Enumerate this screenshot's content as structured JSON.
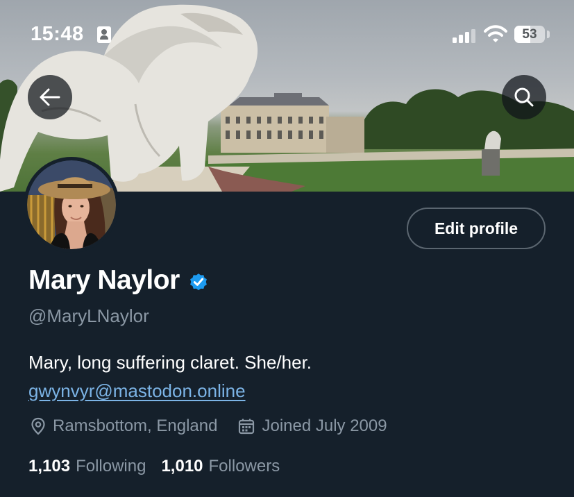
{
  "status_bar": {
    "time": "15:48",
    "battery": "53",
    "battery_level": 0.53
  },
  "header": {
    "back_icon": "arrow-left-icon",
    "search_icon": "search-icon"
  },
  "profile": {
    "edit_button": "Edit profile",
    "name": "Mary Naylor",
    "verified_icon": "verified-badge-icon",
    "handle": "@MaryLNaylor",
    "bio": "Mary, long suffering claret. She/her.",
    "bio_link": "gwynvyr@mastodon.online",
    "location": "Ramsbottom, England",
    "joined": "Joined July 2009",
    "following_count": "1,103",
    "following_label": "Following",
    "followers_count": "1,010",
    "followers_label": "Followers"
  },
  "colors": {
    "background": "#15202b",
    "accent_link": "#7cb4e6",
    "verified": "#1d9bf0",
    "secondary_text": "#8b98a5"
  }
}
